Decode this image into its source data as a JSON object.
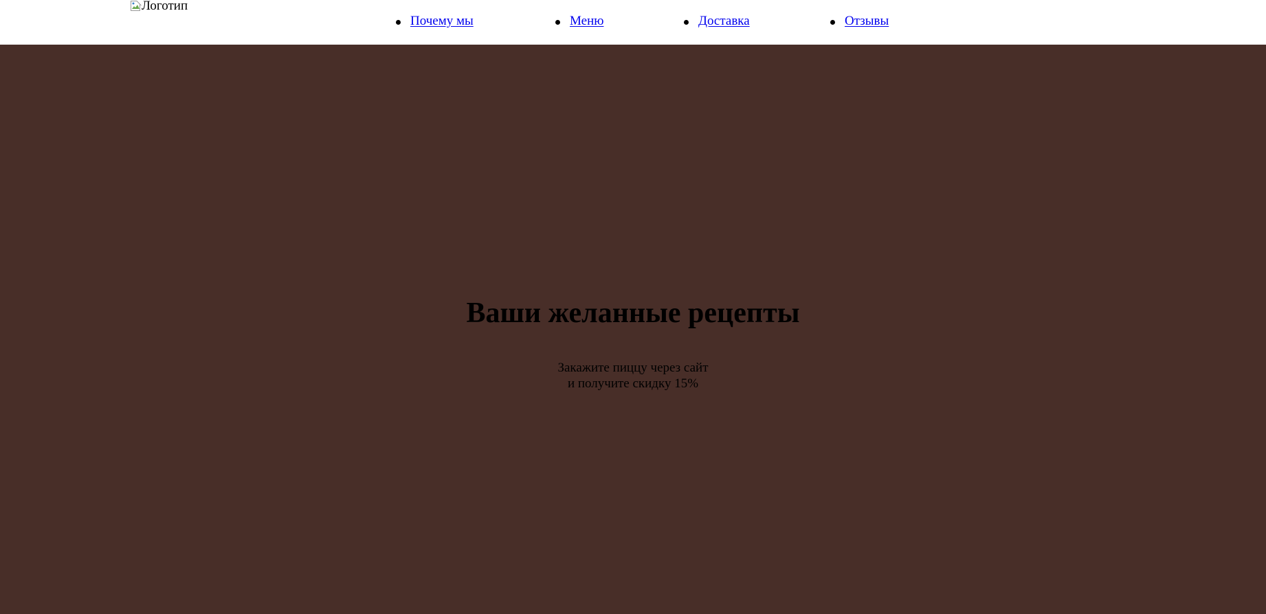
{
  "header": {
    "logo_alt": "Логотип",
    "nav": [
      {
        "label": "Почему мы"
      },
      {
        "label": "Меню"
      },
      {
        "label": "Доставка"
      },
      {
        "label": "Отзывы"
      }
    ]
  },
  "hero": {
    "title": "Ваши желанные рецепты",
    "subtitle_line1": "Закажите пиццу через сайт",
    "subtitle_line2": "и получите скидку 15%"
  },
  "colors": {
    "hero_background": "#482e28",
    "link": "#0000ee",
    "header_background": "#ffffff"
  }
}
